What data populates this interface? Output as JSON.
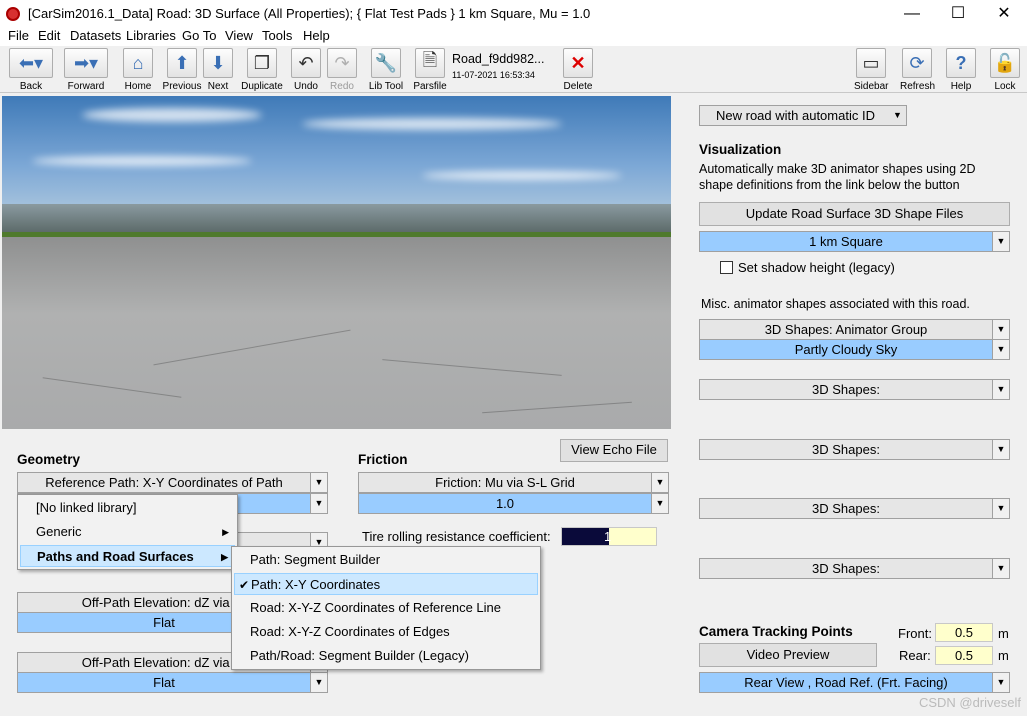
{
  "window": {
    "title": "[CarSim2016.1_Data] Road: 3D Surface (All Properties); { Flat Test Pads } 1 km Square, Mu = 1.0",
    "minimize": "—",
    "maximize": "☐",
    "close": "✕"
  },
  "menu": [
    "File",
    "Edit",
    "Datasets",
    "Libraries",
    "Go To",
    "View",
    "Tools",
    "Help"
  ],
  "toolbar": {
    "back": "Back",
    "forward": "Forward",
    "home": "Home",
    "previous": "Previous",
    "next": "Next",
    "duplicate": "Duplicate",
    "undo": "Undo",
    "redo": "Redo",
    "libtool": "Lib Tool",
    "parsfile": "Parsfile",
    "delete": "Delete",
    "sidebar": "Sidebar",
    "refresh": "Refresh",
    "help": "Help",
    "lock": "Lock",
    "dataset_name": "Road_f9dd982...",
    "dataset_date": "11-07-2021 16:53:34"
  },
  "geometry": {
    "heading": "Geometry",
    "ref_path": "Reference Path: X-Y Coordinates of Path",
    "offpath1_label": "Off-Path Elevation: dZ via S-",
    "offpath1_value": "Flat",
    "offpath2_label": "Off-Path Elevation: dZ via S-",
    "offpath2_value": "Flat"
  },
  "friction": {
    "heading": "Friction",
    "view_echo": "View Echo File",
    "mu_label": "Friction: Mu via S-L Grid",
    "mu_value": "1.0",
    "trr_label": "Tire rolling resistance coefficient:",
    "trr_value": "1"
  },
  "context_menu": {
    "items": [
      "[No linked library]",
      "Generic",
      "Paths and Road Surfaces"
    ],
    "submenu": [
      "Path: Segment Builder",
      "Path: X-Y Coordinates",
      "Road: X-Y-Z Coordinates of Reference Line",
      "Road: X-Y-Z Coordinates of Edges",
      "Path/Road: Segment Builder (Legacy)"
    ],
    "checked_index": 1
  },
  "right": {
    "new_road": "New road with automatic ID",
    "vis_heading": "Visualization",
    "vis_desc1": "Automatically make 3D animator shapes using 2D",
    "vis_desc2": "shape definitions from the link below the button",
    "update_btn": "Update Road Surface 3D Shape Files",
    "shape_file": "1 km Square",
    "shadow_label": "Set shadow height (legacy)",
    "misc_label": "Misc. animator shapes associated with this road.",
    "anim_group": "3D Shapes: Animator Group",
    "sky": "Partly Cloudy Sky",
    "shapes": [
      "3D Shapes:",
      "3D Shapes:",
      "3D Shapes:",
      "3D Shapes:"
    ],
    "camera_heading": "Camera Tracking Points",
    "front_label": "Front:",
    "front_value": "0.5",
    "front_unit": "m",
    "rear_label": "Rear:",
    "rear_value": "0.5",
    "rear_unit": "m",
    "video_btn": "Video Preview",
    "view_select": "Rear View , Road Ref. (Frt. Facing)"
  },
  "watermark": "CSDN @driveself"
}
